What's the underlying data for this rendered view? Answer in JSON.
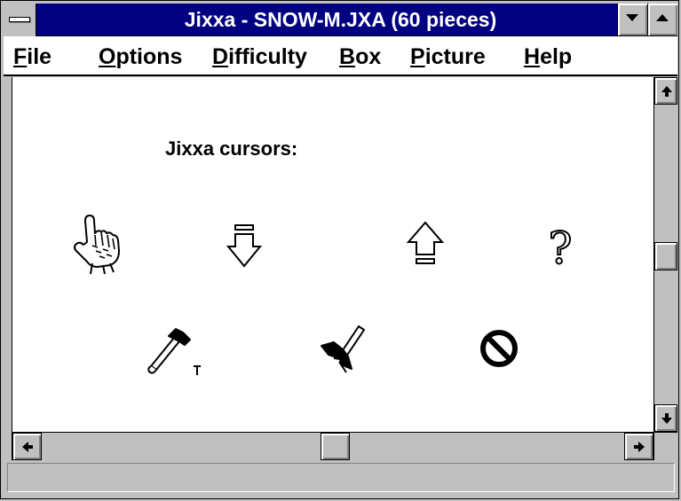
{
  "window": {
    "title": "Jixxa - SNOW-M.JXA (60 pieces)"
  },
  "menu": [
    {
      "first": "F",
      "rest": "ile"
    },
    {
      "first": "O",
      "rest": "ptions"
    },
    {
      "first": "D",
      "rest": "ifficulty"
    },
    {
      "first": "B",
      "rest": "ox"
    },
    {
      "first": "P",
      "rest": "icture"
    },
    {
      "first": "H",
      "rest": "elp"
    }
  ],
  "content": {
    "heading": "Jixxa cursors:",
    "cursors": [
      "hand-pointer-icon",
      "arrow-down-icon",
      "arrow-up-icon",
      "question-mark-icon",
      "hammer-icon",
      "hammer-tilted-icon",
      "no-entry-icon"
    ],
    "question_glyph": "?"
  },
  "scroll": {
    "vertical_position": 0.5,
    "horizontal_position": 0.5
  },
  "status": {
    "text": ""
  },
  "colors": {
    "title_bar": "#000080",
    "face": "#c0c0c0",
    "client": "#ffffff"
  }
}
